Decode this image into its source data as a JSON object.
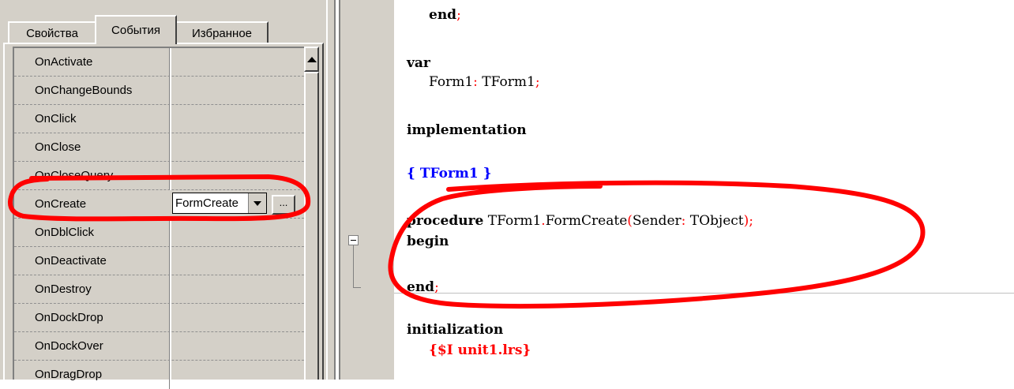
{
  "inspector": {
    "tabs": {
      "properties": "Свойства",
      "events": "События",
      "favorites": "Избранное"
    },
    "events": [
      {
        "name": "OnActivate",
        "value": ""
      },
      {
        "name": "OnChangeBounds",
        "value": ""
      },
      {
        "name": "OnClick",
        "value": ""
      },
      {
        "name": "OnClose",
        "value": ""
      },
      {
        "name": "OnCloseQuery",
        "value": ""
      },
      {
        "name": "OnCreate",
        "value": "FormCreate"
      },
      {
        "name": "OnDblClick",
        "value": ""
      },
      {
        "name": "OnDeactivate",
        "value": ""
      },
      {
        "name": "OnDestroy",
        "value": ""
      },
      {
        "name": "OnDockDrop",
        "value": ""
      },
      {
        "name": "OnDockOver",
        "value": ""
      },
      {
        "name": "OnDragDrop",
        "value": ""
      }
    ],
    "selected_event": "OnCreate",
    "combo_value": "FormCreate",
    "ellipsis_label": "...",
    "icons": {
      "combo": "chevron-down-icon",
      "scroll_up": "arrow-up-icon"
    }
  },
  "editor": {
    "lines": {
      "l0": {
        "kw": "end",
        "sym": ";"
      },
      "l1": {
        "kw": "var"
      },
      "l2": {
        "text": "Form1",
        "sym1": ":",
        "type": " TForm1",
        "sym2": ";"
      },
      "l3": {
        "kw": "implementation"
      },
      "l4": {
        "comment": "{ TForm1 }"
      },
      "l5": {
        "kw": "procedure",
        "a": " TForm1",
        "dot": ".",
        "b": "FormCreate",
        "p1": "(",
        "c": "Sender",
        "colon": ":",
        "d": " TObject",
        "p2": ")",
        "semi": ";"
      },
      "l6": {
        "kw": "begin"
      },
      "l7": {
        "kw": "end",
        "sym": ";"
      },
      "l8": {
        "kw": "initialization"
      },
      "l9": {
        "directive": "{$I unit1.lrs}"
      }
    },
    "colors": {
      "keyword": "#000000",
      "symbol": "#ff0000",
      "comment": "#0000ff",
      "annotation": "#ff0000"
    }
  }
}
